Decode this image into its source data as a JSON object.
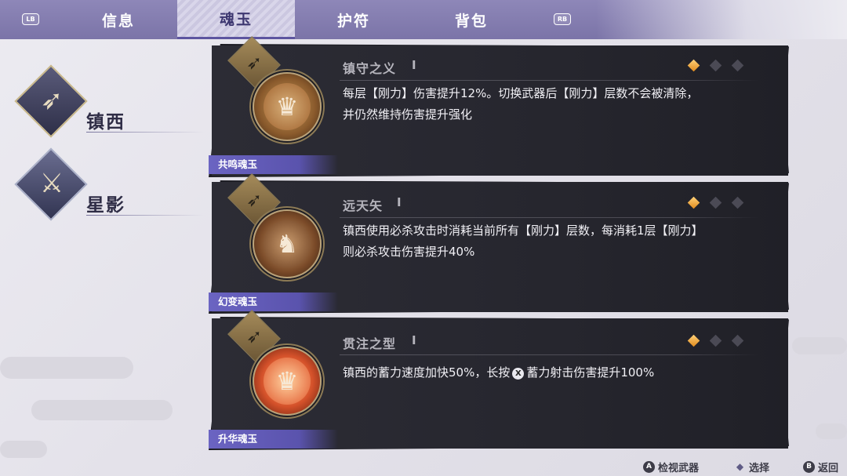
{
  "tabs": {
    "lb": "LB",
    "rb": "RB",
    "items": [
      {
        "label": "信息"
      },
      {
        "label": "魂玉"
      },
      {
        "label": "护符"
      },
      {
        "label": "背包"
      }
    ],
    "active_index": 1
  },
  "weapons": [
    {
      "name": "镇西",
      "icon": "bow-weapon-icon"
    },
    {
      "name": "星影",
      "icon": "blade-weapon-icon"
    }
  ],
  "cards": [
    {
      "title": "镇守之义",
      "level": "I",
      "jade_type": "共鸣魂玉",
      "jade_icon": "lion-mask-icon",
      "rarity_lit": 1,
      "rarity_total": 3,
      "desc_lines": [
        "每层【刚力】伤害提升12%。切换武器后【刚力】层数不会被清除，",
        "并仍然维持伤害提升强化"
      ]
    },
    {
      "title": "远天矢",
      "level": "I",
      "jade_type": "幻变魂玉",
      "jade_icon": "beast-icon",
      "rarity_lit": 1,
      "rarity_total": 3,
      "desc_lines": [
        "镇西使用必杀攻击时消耗当前所有【刚力】层数，每消耗1层【刚力】",
        "则必杀攻击伤害提升40%"
      ]
    },
    {
      "title": "贯注之型",
      "level": "I",
      "jade_type": "升华魂玉",
      "jade_icon": "flaming-mask-icon",
      "rarity_lit": 1,
      "rarity_total": 3,
      "desc_before": "镇西的蓄力速度加快50%，长按",
      "desc_button": "X",
      "desc_after": "蓄力射击伤害提升100%"
    }
  ],
  "hints": [
    {
      "key": "A",
      "label": "检视武器"
    },
    {
      "key": "◆",
      "label": "选择"
    },
    {
      "key": "B",
      "label": "返回"
    }
  ],
  "colors": {
    "topbar": "#7b74a8",
    "active_tab": "#cbc7e0",
    "jade_label": "#6b64c2",
    "card_bg": "#26262e",
    "rarity_gem": "#e08a1c"
  }
}
